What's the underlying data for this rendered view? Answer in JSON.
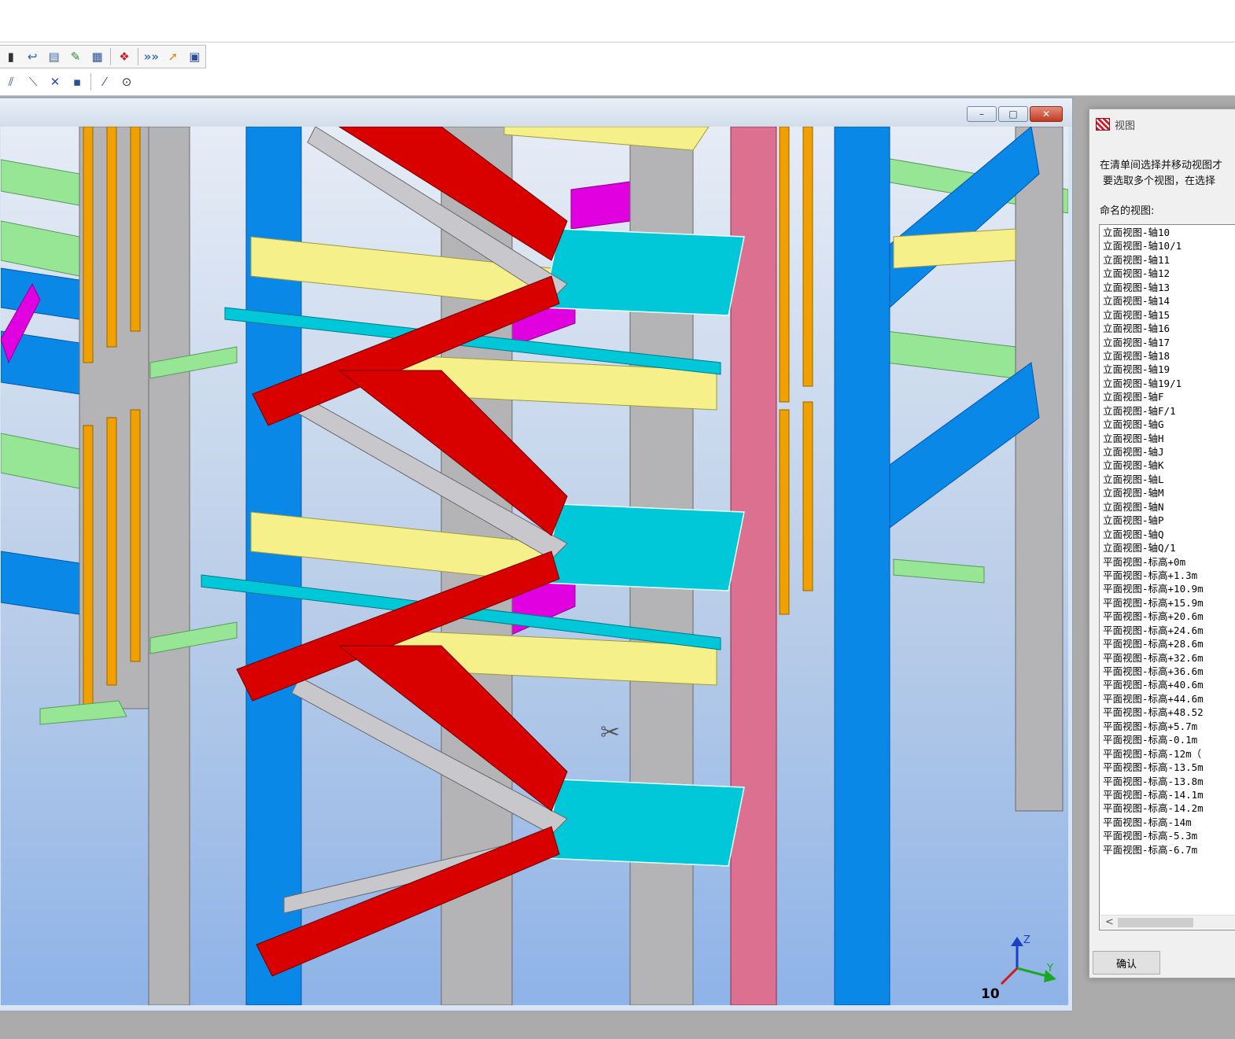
{
  "toolbar": {
    "row1_icons": [
      "open-icon",
      "undo-icon",
      "properties-icon",
      "drawing-icon",
      "report-icon",
      "tekla-logo-icon",
      "macro-icon",
      "export-icon",
      "catalog-icon"
    ],
    "row2_icons": [
      "snap-line-icon",
      "snap-perpendicular-icon",
      "snap-intersection-icon",
      "snap-point-icon",
      "snap-extension-icon",
      "snap-center-icon"
    ]
  },
  "viewport": {
    "window_buttons": {
      "minimize": "–",
      "maximize": "□",
      "close": "✕"
    },
    "axis_labels": {
      "z": "Z",
      "y": "Y"
    },
    "view_number": "10",
    "colors": {
      "background_top": "#e6ecf6",
      "background_bottom": "#8eb3e8",
      "stair_red": "#d90000",
      "beam_yellow": "#f5f08a",
      "column_blue": "#0a88e8",
      "steel_grey": "#b4b4b6",
      "floor_cyan": "#00c8d8",
      "magenta": "#e000e0",
      "orange": "#f0a000",
      "pink_column": "#dc7090",
      "light_green": "#96e696"
    }
  },
  "dialog": {
    "title": "视图",
    "instructions": [
      "在清单间选择并移动视图才",
      "要选取多个视图，在选择"
    ],
    "list_label": "命名的视图:",
    "views": [
      "立面视图-轴10",
      "立面视图-轴10/1",
      "立面视图-轴11",
      "立面视图-轴12",
      "立面视图-轴13",
      "立面视图-轴14",
      "立面视图-轴15",
      "立面视图-轴16",
      "立面视图-轴17",
      "立面视图-轴18",
      "立面视图-轴19",
      "立面视图-轴19/1",
      "立面视图-轴F",
      "立面视图-轴F/1",
      "立面视图-轴G",
      "立面视图-轴H",
      "立面视图-轴J",
      "立面视图-轴K",
      "立面视图-轴L",
      "立面视图-轴M",
      "立面视图-轴N",
      "立面视图-轴P",
      "立面视图-轴Q",
      "立面视图-轴Q/1",
      "平面视图-标高+0m",
      "平面视图-标高+1.3m",
      "平面视图-标高+10.9m",
      "平面视图-标高+15.9m",
      "平面视图-标高+20.6m",
      "平面视图-标高+24.6m",
      "平面视图-标高+28.6m",
      "平面视图-标高+32.6m",
      "平面视图-标高+36.6m",
      "平面视图-标高+40.6m",
      "平面视图-标高+44.6m",
      "平面视图-标高+48.52",
      "平面视图-标高+5.7m",
      "平面视图-标高-0.1m",
      "平面视图-标高-12m（",
      "平面视图-标高-13.5m",
      "平面视图-标高-13.8m",
      "平面视图-标高-14.1m",
      "平面视图-标高-14.2m",
      "平面视图-标高-14m",
      "平面视图-标高-5.3m",
      "平面视图-标高-6.7m"
    ],
    "scroll_left": "<",
    "scroll_right": ">",
    "ok_label": "确认"
  }
}
